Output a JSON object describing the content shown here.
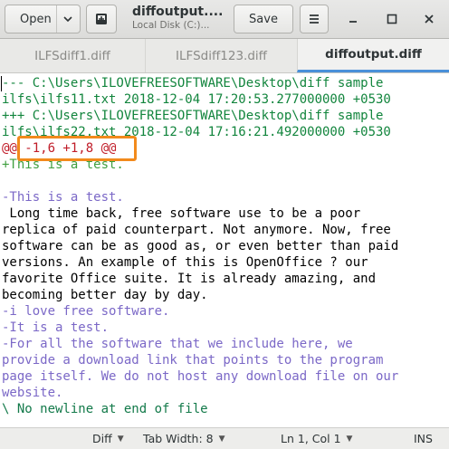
{
  "header": {
    "open_label": "Open",
    "title": "diffoutput....",
    "subtitle": "Local Disk (C:)...",
    "save_label": "Save"
  },
  "tabs": [
    {
      "label": "ILFSdiff1.diff",
      "active": false
    },
    {
      "label": "ILFSdiff123.diff",
      "active": false
    },
    {
      "label": "diffoutput.diff",
      "active": true
    }
  ],
  "editor": {
    "lines": [
      {
        "text": "--- C:\\Users\\ILOVEFREESOFTWARE\\Desktop\\diff sample",
        "kind": "header"
      },
      {
        "text": "ilfs\\ilfs11.txt 2018-12-04 17:20:53.277000000 +0530",
        "kind": "header"
      },
      {
        "text": "+++ C:\\Users\\ILOVEFREESOFTWARE\\Desktop\\diff sample",
        "kind": "header"
      },
      {
        "text": "ilfs\\ilfs22.txt 2018-12-04 17:16:21.492000000 +0530",
        "kind": "header"
      },
      {
        "text": "@@ -1,6 +1,8 @@",
        "kind": "hunk"
      },
      {
        "text": "+This is a test.",
        "kind": "added"
      },
      {
        "text": "",
        "kind": "context"
      },
      {
        "text": "-This is a test.",
        "kind": "removed"
      },
      {
        "text": " Long time back, free software use to be a poor",
        "kind": "context"
      },
      {
        "text": "replica of paid counterpart. Not anymore. Now, free",
        "kind": "context"
      },
      {
        "text": "software can be as good as, or even better than paid",
        "kind": "context"
      },
      {
        "text": "versions. An example of this is OpenOffice ? our",
        "kind": "context"
      },
      {
        "text": "favorite Office suite. It is already amazing, and",
        "kind": "context"
      },
      {
        "text": "becoming better day by day.",
        "kind": "context"
      },
      {
        "text": "-i love free software.",
        "kind": "removed"
      },
      {
        "text": "-It is a test.",
        "kind": "removed"
      },
      {
        "text": "-For all the software that we include here, we",
        "kind": "removed"
      },
      {
        "text": "provide a download link that points to the program",
        "kind": "removed"
      },
      {
        "text": "page itself. We do not host any download file on our",
        "kind": "removed"
      },
      {
        "text": "website.",
        "kind": "removed"
      },
      {
        "text": "\\ No newline at end of file",
        "kind": "nonewline"
      }
    ]
  },
  "statusbar": {
    "language": "Diff",
    "tab_width": "Tab Width: 8",
    "position": "Ln 1, Col 1",
    "mode": "INS"
  },
  "colors": {
    "header": "#12853d",
    "hunk": "#c01c28",
    "added": "#3f9f3f",
    "removed": "#7b68c7",
    "highlight": "#f28a1c",
    "active_tab_underline": "#4a90d9"
  },
  "icons": {
    "open_dropdown": "chevron-down-icon",
    "new_document": "new-document-icon",
    "menu": "hamburger-menu-icon",
    "minimize": "minimize-icon",
    "maximize": "maximize-icon",
    "close": "close-icon"
  }
}
